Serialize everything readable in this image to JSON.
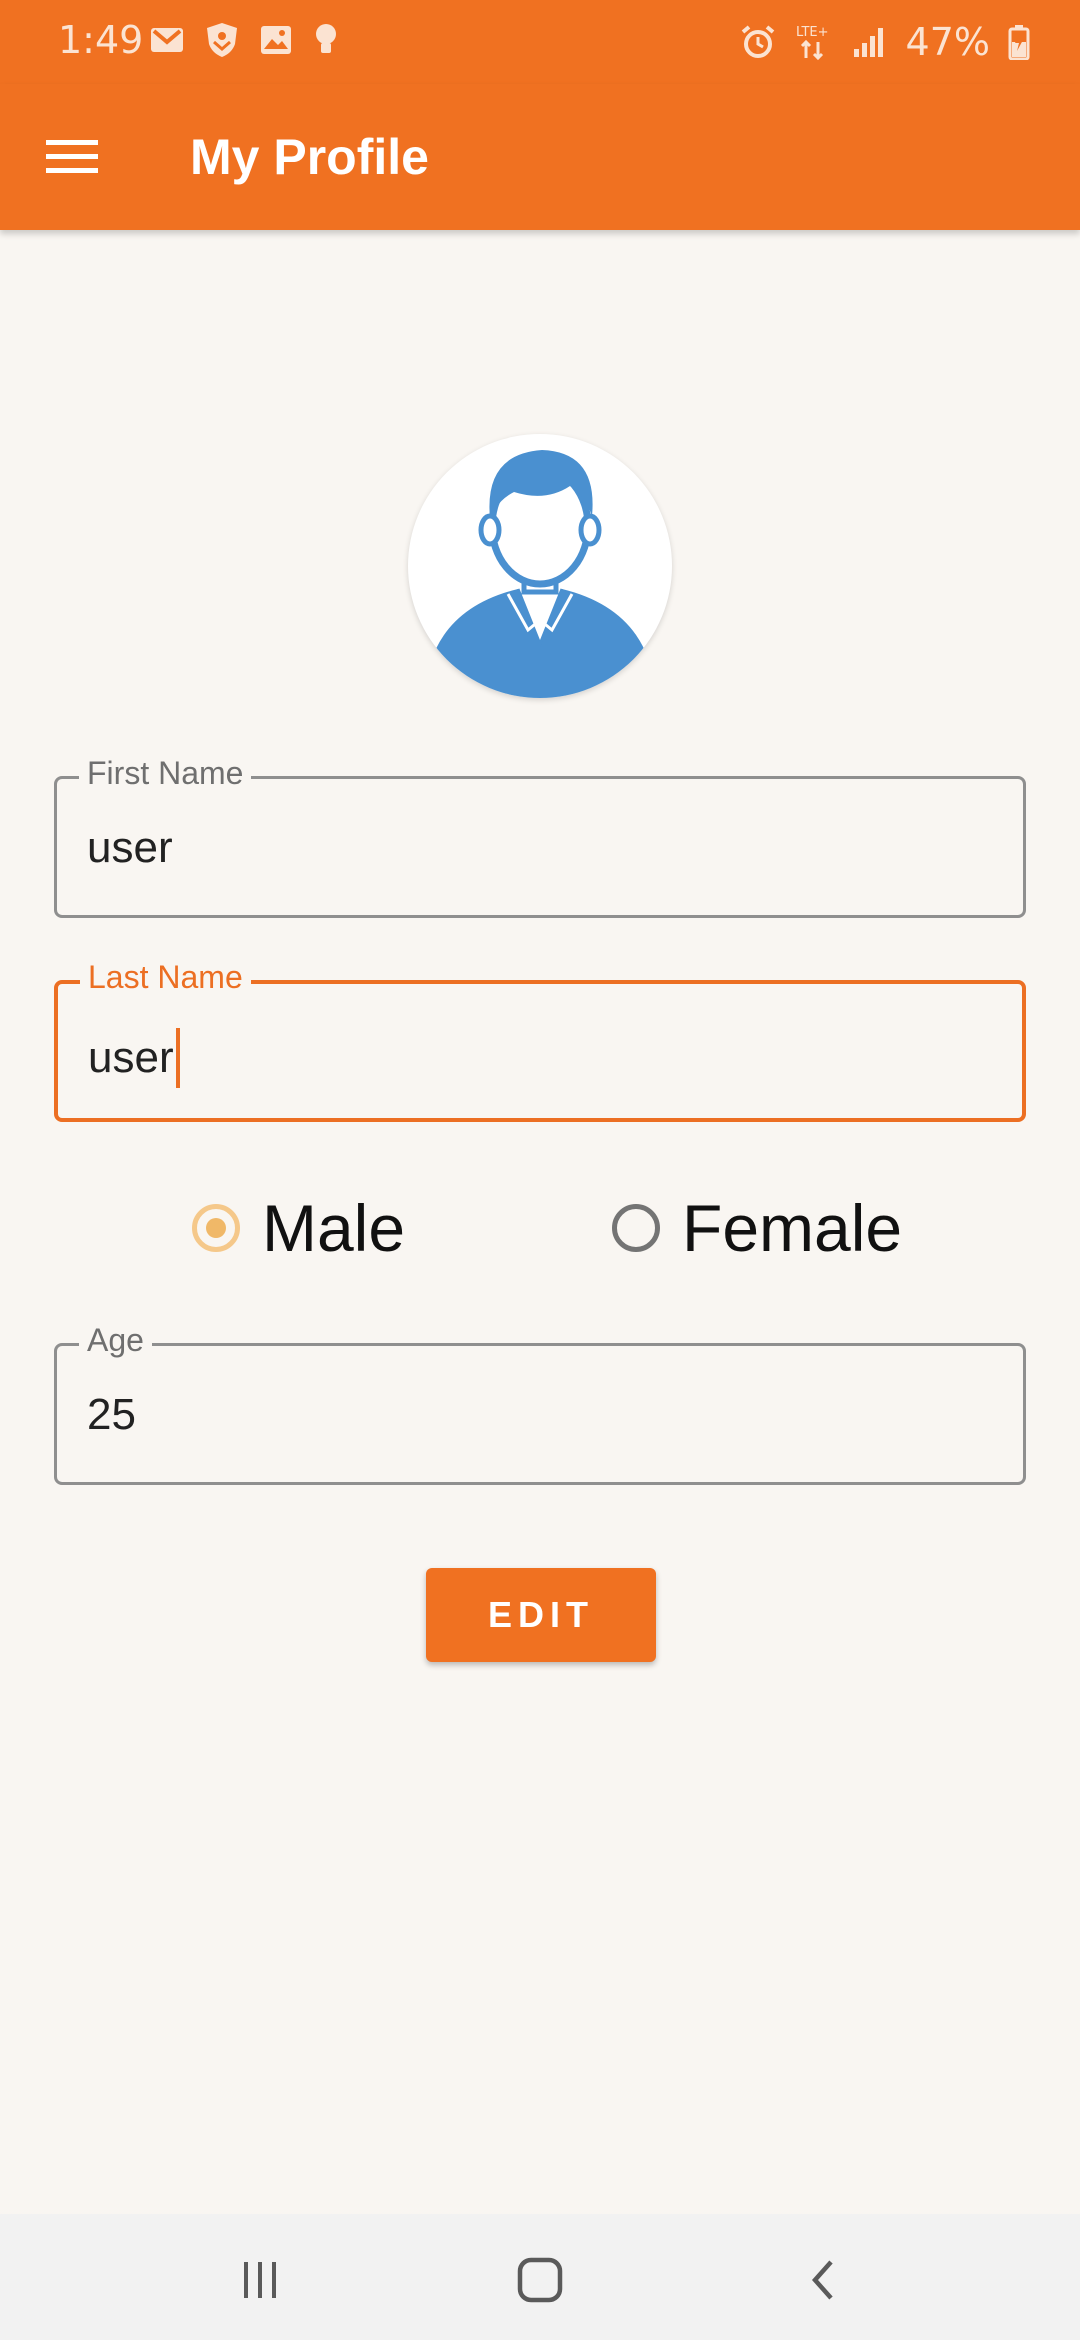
{
  "status_bar": {
    "time": "1:49",
    "battery_percent": "47%",
    "left_icons": [
      "gmail-icon",
      "shield-app-icon",
      "gallery-icon",
      "bulb-icon"
    ],
    "right_icons": [
      "alarm-icon",
      "lte-plus-icon",
      "signal-icon",
      "battery-charging-icon"
    ]
  },
  "app_bar": {
    "title": "My Profile",
    "menu_icon": "hamburger-menu-icon",
    "color": "#f07121"
  },
  "profile": {
    "avatar_icon": "user-avatar-icon",
    "first_name": {
      "label": "First Name",
      "value": "user"
    },
    "last_name": {
      "label": "Last Name",
      "value": "user"
    },
    "gender": {
      "options": [
        "Male",
        "Female"
      ],
      "selected": "Male"
    },
    "age": {
      "label": "Age",
      "value": "25"
    }
  },
  "actions": {
    "edit_label": "EDIT"
  },
  "nav_bar": {
    "icons": [
      "recent-apps-icon",
      "home-icon",
      "back-icon"
    ]
  },
  "colors": {
    "accent": "#f07121",
    "focus": "#ec6f23",
    "background": "#f9f6f2",
    "avatar_blue": "#4a90d0"
  }
}
